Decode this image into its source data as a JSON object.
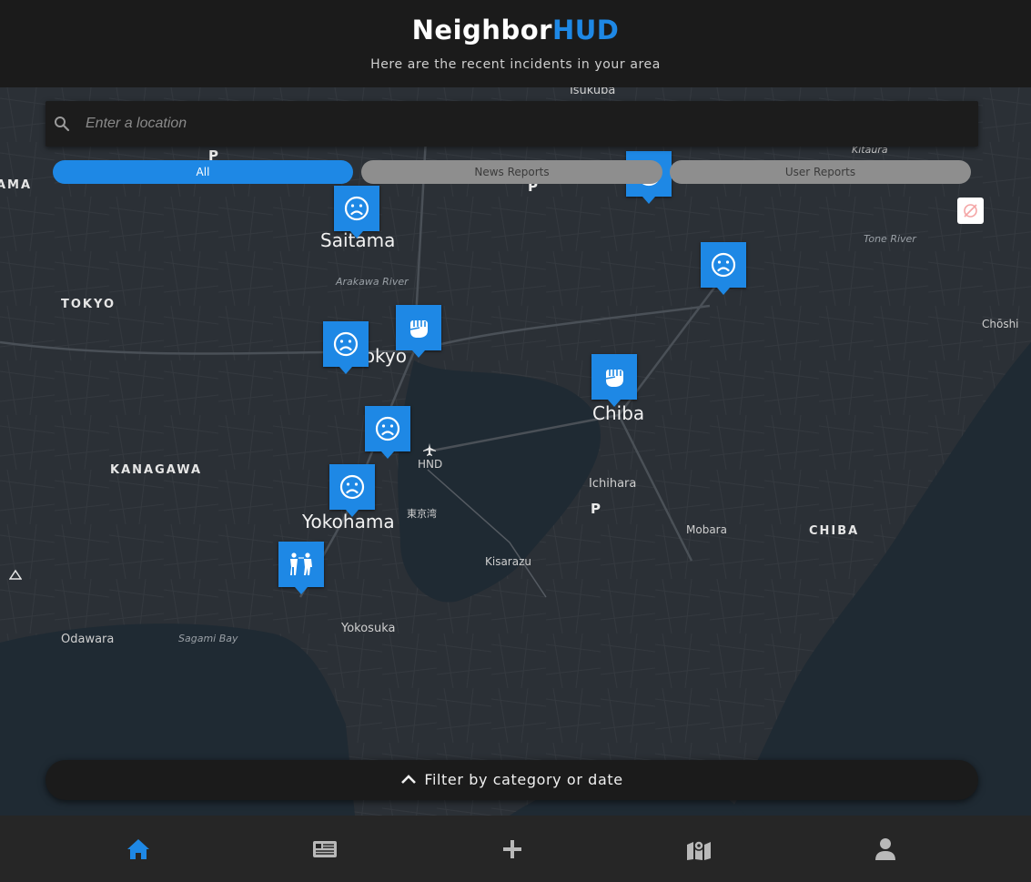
{
  "header": {
    "brand_part1": "Neighbor",
    "brand_part2": "HUD",
    "subtitle": "Here are the recent incidents in your area",
    "accent_color": "#1e88e5"
  },
  "search": {
    "placeholder": "Enter a location",
    "value": "",
    "icon": "search-icon"
  },
  "tabs": [
    {
      "label": "All",
      "active": true
    },
    {
      "label": "News Reports",
      "active": false
    },
    {
      "label": "User Reports",
      "active": false
    }
  ],
  "map": {
    "region_labels": [
      "AMA",
      "TOKYO",
      "KANAGAWA",
      "CHIBA"
    ],
    "city_labels": [
      "Saitama",
      "Tokyo",
      "Chiba",
      "Yokohama"
    ],
    "town_labels": [
      "Tsukuba",
      "Kitaura",
      "Chōshi",
      "Ichihara",
      "Mobara",
      "Kisarazu",
      "Yokosuka",
      "Odawara",
      "HND",
      "東京湾"
    ],
    "water_labels": [
      "Arakawa River",
      "Tone River",
      "Sagami Bay"
    ],
    "parking_label": "P",
    "markers": [
      {
        "icon": "sad-face-icon"
      },
      {
        "icon": "sad-face-icon"
      },
      {
        "icon": "sad-face-icon"
      },
      {
        "icon": "sad-face-icon"
      },
      {
        "icon": "sad-face-icon"
      },
      {
        "icon": "sad-face-icon"
      },
      {
        "icon": "fist-icon"
      },
      {
        "icon": "fist-icon"
      },
      {
        "icon": "people-icon"
      }
    ]
  },
  "filter": {
    "label": "Filter by category or date"
  },
  "bottom_nav": [
    {
      "icon": "home-icon",
      "active": true
    },
    {
      "icon": "news-icon",
      "active": false
    },
    {
      "icon": "plus-icon",
      "active": false
    },
    {
      "icon": "map-icon",
      "active": false
    },
    {
      "icon": "profile-icon",
      "active": false
    }
  ]
}
